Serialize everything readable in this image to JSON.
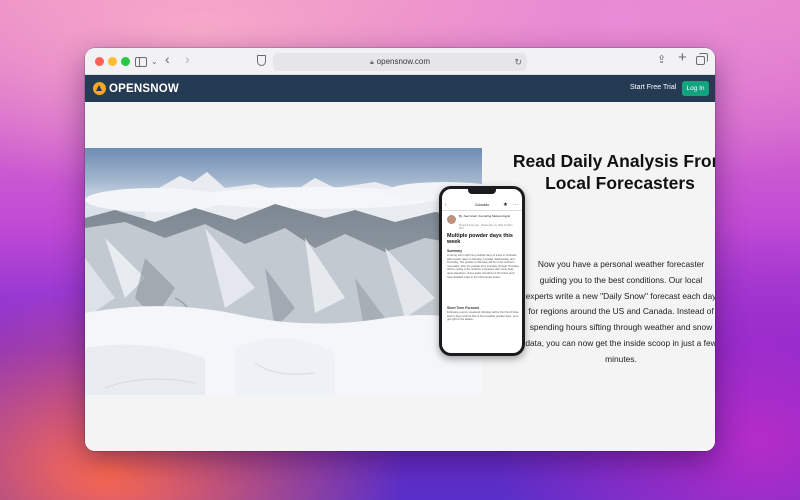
{
  "browser": {
    "url": "opensnow.com"
  },
  "site": {
    "logo_text": "OPENSNOW",
    "nav": {
      "trial_label": "Start Free Trial",
      "login_label": "Log In"
    }
  },
  "feature": {
    "heading": "Read Daily Analysis From Local Forecasters",
    "body": "Now you have a personal weather forecaster guiding you to the best conditions. Our local experts write a new \"Daily Snow\" forecast each day for regions around the US and Canada. Instead of spending hours sifting through weather and snow data, you can now get the inside scoop in just a few minutes."
  },
  "phone": {
    "region": "Colorado",
    "author": "By Joel Gratz, Founding Meteorologist",
    "meta": "Posted 8 hours ago · Wednesday, 21, 2022 11:00am MST",
    "post_title": "Multiple powder days this week",
    "summary_heading": "Summary",
    "summary_text": "A strong storm will bring multiple days of snow to Colorado with powder days on Monday, Tuesday, Wednesday, and Thursday. The powder on Monday will be in the southern mountains, then the powder from Tuesday through Thursday will be mostly in the northern mountains with some deep quiet elsewhere. Snow totals should be 6-18 inches and I have detailed maps in the full forecast below.",
    "short_heading": "Short Term Forecast",
    "short_text": "Following a sunny weekend, Monday will be the first of three stormy days and the first of four possible powder days. Let's get right to the details."
  }
}
